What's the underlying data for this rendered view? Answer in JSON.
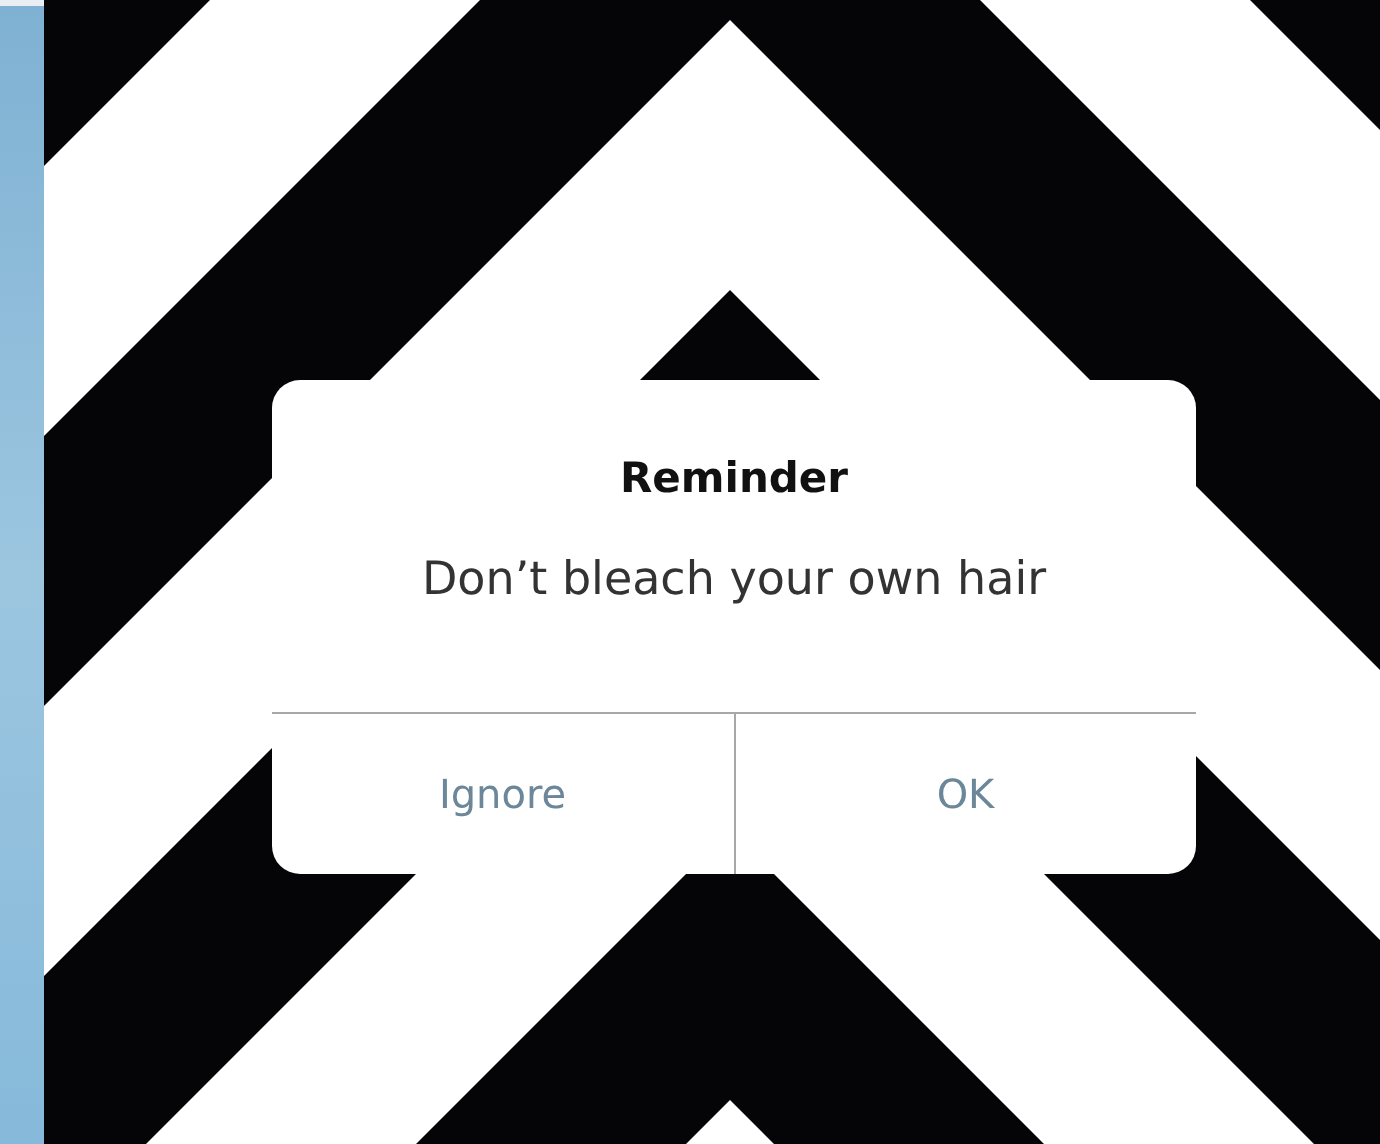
{
  "alert": {
    "title": "Reminder",
    "message": "Don’t bleach your own hair",
    "buttons": [
      {
        "label": "Ignore"
      },
      {
        "label": "OK"
      }
    ]
  }
}
